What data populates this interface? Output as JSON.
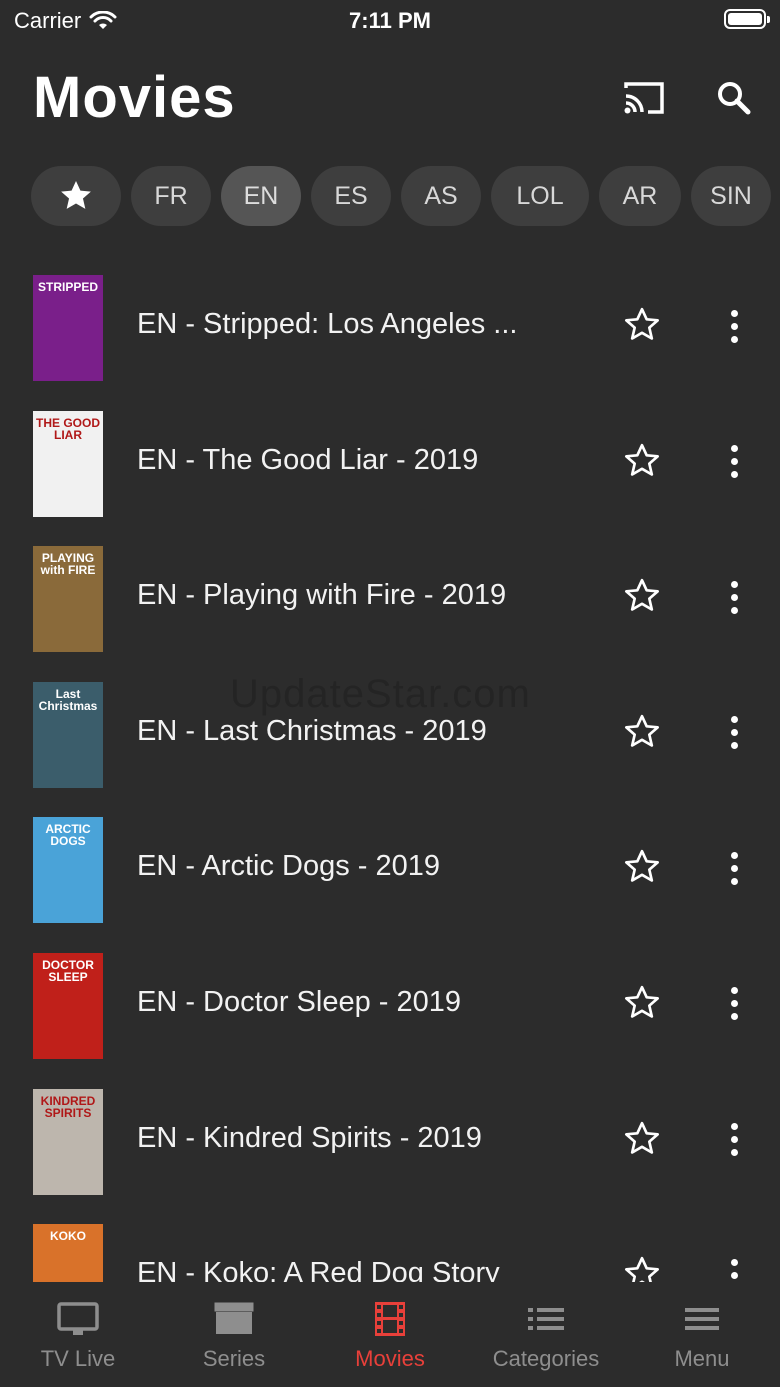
{
  "status": {
    "carrier": "Carrier",
    "time": "7:11 PM"
  },
  "header": {
    "title": "Movies"
  },
  "chips": [
    {
      "label": "",
      "icon": "star-icon"
    },
    {
      "label": "FR"
    },
    {
      "label": "EN",
      "active": true
    },
    {
      "label": "ES"
    },
    {
      "label": "AS"
    },
    {
      "label": "LOL"
    },
    {
      "label": "AR"
    },
    {
      "label": "SIN"
    }
  ],
  "movies": [
    {
      "title": "EN - Stripped: Los Angeles ...",
      "poster_text": "STRIPPED",
      "poster_color": "#7a1f8a"
    },
    {
      "title": "EN - The Good Liar - 2019",
      "poster_text": "THE GOOD LIAR",
      "poster_color": "#f1f1f1"
    },
    {
      "title": "EN - Playing with Fire - 2019",
      "poster_text": "PLAYING with FIRE",
      "poster_color": "#8a6a3a"
    },
    {
      "title": "EN - Last Christmas - 2019",
      "poster_text": "Last Christmas",
      "poster_color": "#3b5d6b"
    },
    {
      "title": "EN - Arctic Dogs - 2019",
      "poster_text": "ARCTIC DOGS",
      "poster_color": "#4aa3d8"
    },
    {
      "title": "EN - Doctor Sleep - 2019",
      "poster_text": "DOCTOR SLEEP",
      "poster_color": "#c0201a"
    },
    {
      "title": "EN - Kindred Spirits - 2019",
      "poster_text": "KINDRED SPIRITS",
      "poster_color": "#bdb6ad"
    },
    {
      "title": "EN - Koko: A Red Dog Story",
      "poster_text": "KOKO",
      "poster_color": "#d9722a"
    }
  ],
  "watermark": "UpdateStar.com",
  "tabs": [
    {
      "label": "TV Live",
      "icon": "tv-icon"
    },
    {
      "label": "Series",
      "icon": "clapperboard-icon"
    },
    {
      "label": "Movies",
      "icon": "film-icon",
      "active": true
    },
    {
      "label": "Categories",
      "icon": "list-icon"
    },
    {
      "label": "Menu",
      "icon": "hamburger-icon"
    }
  ],
  "colors": {
    "background": "#2c2c2c",
    "chip": "#3e3e3e",
    "chip_active": "#555555",
    "accent": "#e8403a",
    "tab_inactive": "#8e8e8e"
  }
}
